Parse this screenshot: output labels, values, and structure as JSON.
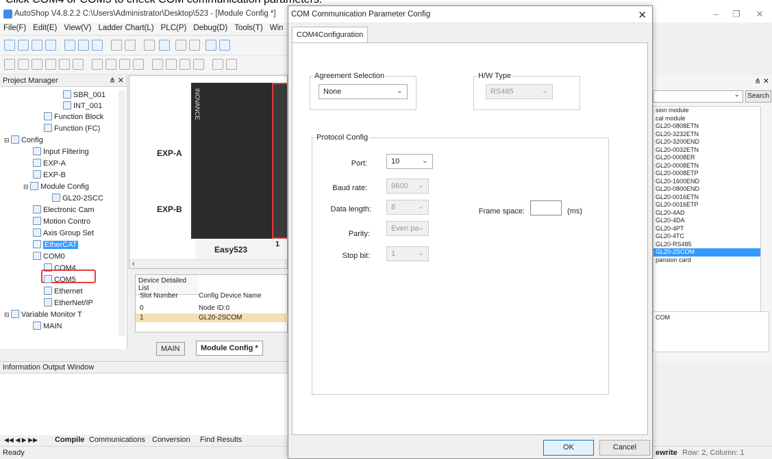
{
  "instruction": "Click COM4 or COM5 to check COM communication parameters.",
  "app": {
    "title": "AutoShop V4.8.2.2  C:\\Users\\Administrator\\Desktop\\523 - [Module Config *]"
  },
  "menu": [
    "File(F)",
    "Edit(E)",
    "View(V)",
    "Ladder Chart(L)",
    "PLC(P)",
    "Debug(D)",
    "Tools(T)",
    "Win"
  ],
  "project_manager": {
    "title": "Project Manager",
    "items": {
      "sbr": "SBR_001",
      "int": "INT_001",
      "fb": "Function Block",
      "fc": "Function (FC)",
      "config": "Config",
      "input_filtering": "Input Filtering",
      "expa": "EXP-A",
      "expb": "EXP-B",
      "module_config": "Module Config",
      "gl20": "GL20-2SCC",
      "ecam": "Electronic Cam",
      "motion": "Motion Contro",
      "axis": "Axis Group Set",
      "ethercat": "EtherCAT",
      "com0": "COM0",
      "com4": "COM4",
      "com5": "COM5",
      "ethernet": "Ethernet",
      "ethernetip": "EtherNet/IP",
      "varmon": "Variable Monitor T",
      "main": "MAIN"
    }
  },
  "canvas": {
    "exp_a": "EXP-A",
    "exp_b": "EXP-B",
    "model": "Easy523",
    "slot_label": "1",
    "brand": "INOVANCE"
  },
  "device_list": {
    "tab": "Device Detailed List",
    "headers": [
      "Slot Number",
      "Config Device Name"
    ],
    "rows": [
      {
        "slot": "0",
        "name": "Node ID:0"
      },
      {
        "slot": "1",
        "name": "GL20-2SCOM"
      }
    ]
  },
  "doc_tabs": {
    "main": "MAIN",
    "module_config": "Module Config *"
  },
  "output": {
    "title": "Information Output Window",
    "tabs": [
      "Compile",
      "Communications",
      "Conversion",
      "Find Results"
    ]
  },
  "status": {
    "left": "Ready",
    "mode": "ewrite",
    "row": "Row:  2, Column:  1"
  },
  "right_panel": {
    "search_label": "Search",
    "items": [
      "sion module",
      "cal module",
      "GL20-0808ETN",
      "GL20-3232ETN",
      "GL20-3200END",
      "GL20-0032ETN",
      "GL20-0008ER",
      "GL20-0008ETN",
      "GL20-0008ETP",
      "GL20-1600END",
      "GL20-0800END",
      "GL20-0016ETN",
      "GL20-0016ETP",
      "GL20-4AD",
      "GL20-4DA",
      "GL20-4PT",
      "GL20-4TC",
      "GL20-RS485",
      "GL20-2SCOM",
      "pansion card"
    ],
    "selected_index": 18,
    "desc": "COM"
  },
  "dialog": {
    "title": "COM Communication Parameter Config",
    "tab": "COM4Configuration",
    "agreement_label": "Agreement Selection",
    "agreement_value": "None",
    "hw_label": "H/W Type",
    "hw_value": "RS485",
    "protocol_label": "Protocol Config",
    "port_label": "Port:",
    "port_value": "10",
    "baud_label": "Baud rate:",
    "baud_value": "9600",
    "datalen_label": "Data length:",
    "datalen_value": "8",
    "parity_label": "Parity:",
    "parity_value": "Even pa",
    "stopbit_label": "Stop bit:",
    "stopbit_value": "1",
    "frame_label": "Frame space:",
    "frame_value": "",
    "frame_unit": "(ms)",
    "ok": "OK",
    "cancel": "Cancel"
  },
  "colors": {
    "accent": "#3399ff",
    "highlight": "#e23b3b",
    "selected_row": "#f5deb3"
  }
}
